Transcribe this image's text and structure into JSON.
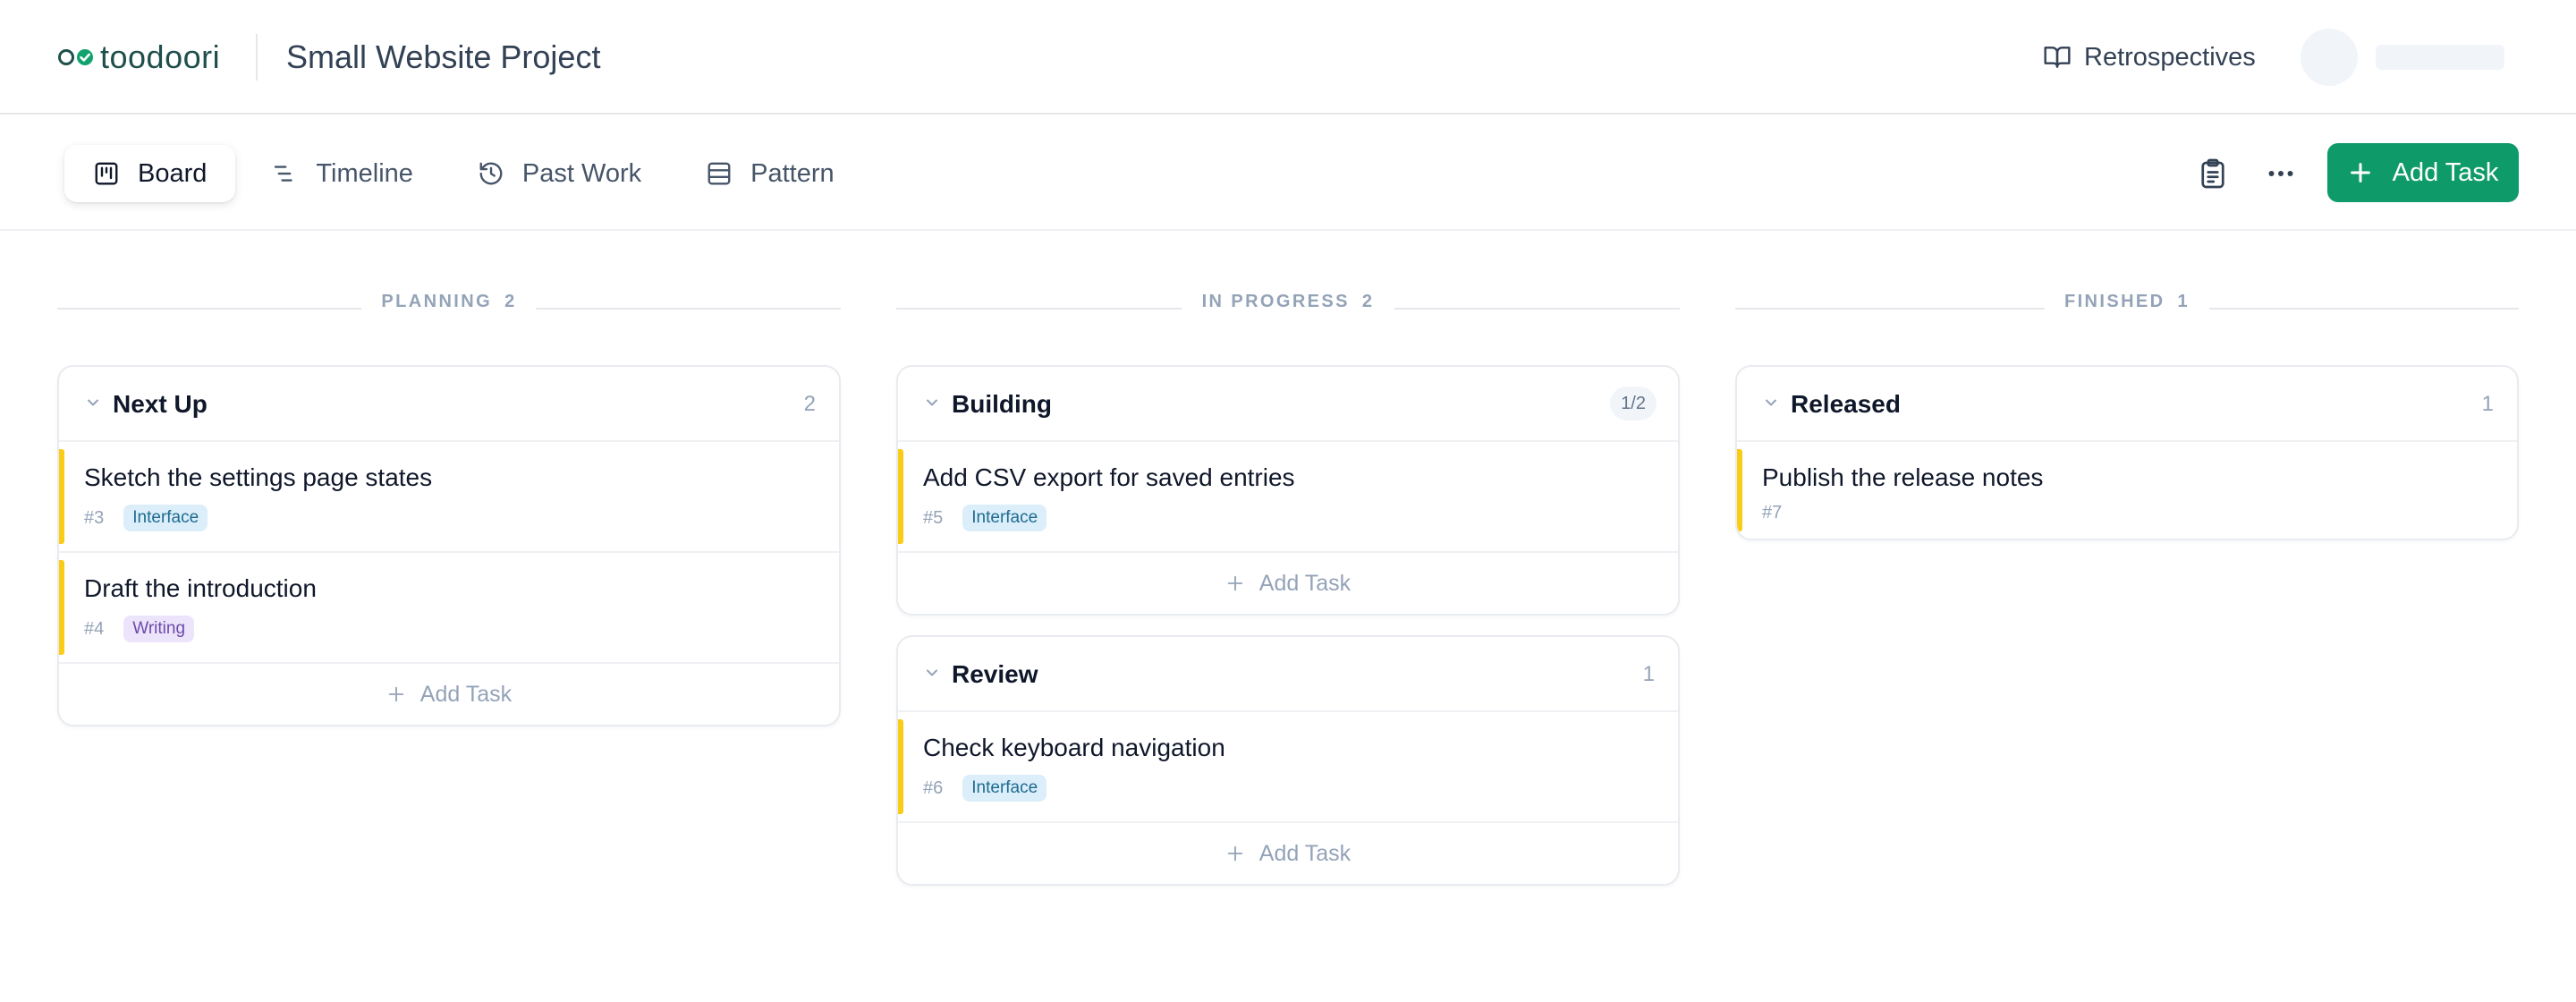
{
  "header": {
    "logo_text": "toodoori",
    "project_title": "Small Website Project",
    "retro_label": "Retrospectives"
  },
  "toolbar": {
    "tabs": [
      {
        "label": "Board",
        "icon": "board-icon",
        "active": true
      },
      {
        "label": "Timeline",
        "icon": "timeline-icon",
        "active": false
      },
      {
        "label": "Past Work",
        "icon": "history-icon",
        "active": false
      },
      {
        "label": "Pattern",
        "icon": "pattern-icon",
        "active": false
      }
    ],
    "add_task_label": "Add Task"
  },
  "colors": {
    "accent": "#0f9b69",
    "task_bar": "#facc15"
  },
  "columns": [
    {
      "label": "PLANNING",
      "count": "2",
      "groups": [
        {
          "name": "Next Up",
          "count": "2",
          "tasks": [
            {
              "title": "Sketch the settings page states",
              "num": "#3",
              "tag": "Interface"
            },
            {
              "title": "Draft the introduction",
              "num": "#4",
              "tag": "Writing"
            }
          ],
          "add_label": "Add Task"
        }
      ]
    },
    {
      "label": "IN PROGRESS",
      "count": "2",
      "groups": [
        {
          "name": "Building",
          "count": "1/2",
          "tasks": [
            {
              "title": "Add CSV export for saved entries",
              "num": "#5",
              "tag": "Interface"
            }
          ],
          "add_label": "Add Task"
        },
        {
          "name": "Review",
          "count": "1",
          "tasks": [
            {
              "title": "Check keyboard navigation",
              "num": "#6",
              "tag": "Interface"
            }
          ],
          "add_label": "Add Task"
        }
      ]
    },
    {
      "label": "FINISHED",
      "count": "1",
      "groups": [
        {
          "name": "Released",
          "count": "1",
          "tasks": [
            {
              "title": "Publish the release notes",
              "num": "#7",
              "tag": ""
            }
          ]
        }
      ]
    }
  ]
}
